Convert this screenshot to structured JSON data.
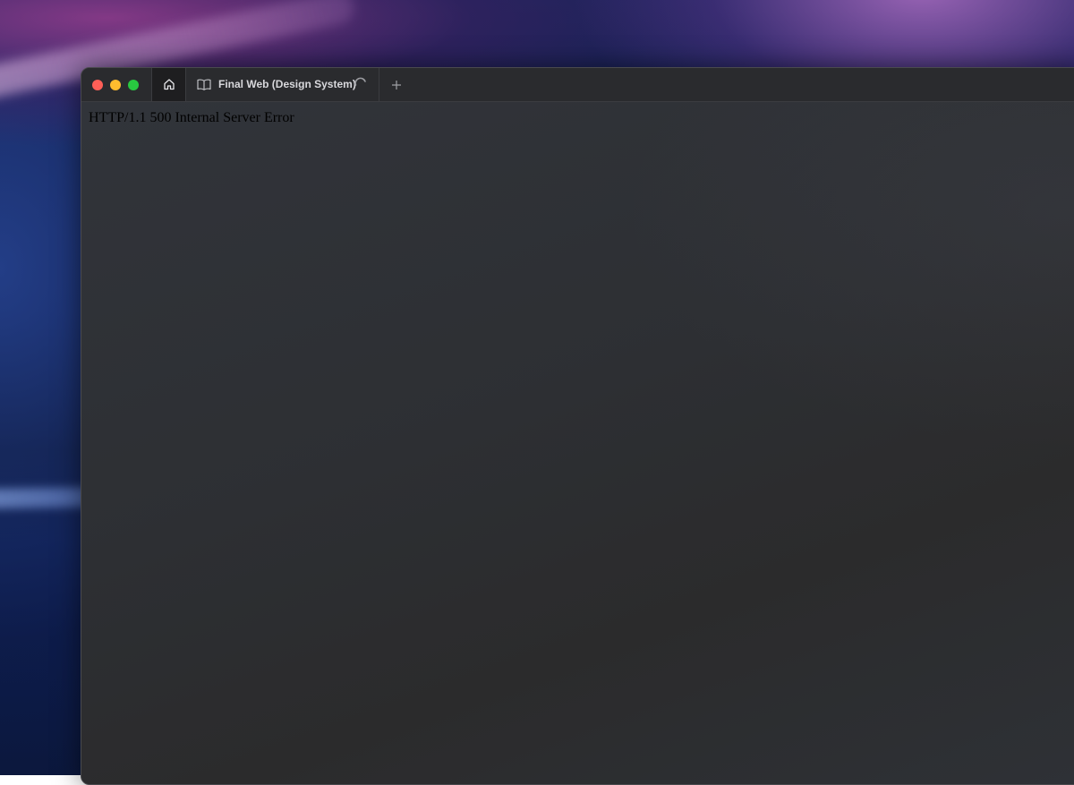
{
  "window": {
    "tabs": [
      {
        "icon": "home-icon"
      },
      {
        "icon": "book-icon",
        "label": "Final Web (Design System)",
        "loading": true
      }
    ],
    "new_tab_icon": "plus-icon"
  },
  "content": {
    "error_message": "HTTP/1.1 500 Internal Server Error"
  },
  "colors": {
    "close": "#ff5f57",
    "minimize": "#febc2e",
    "maximize": "#28c840",
    "window_bg": "#2c2c2e"
  }
}
